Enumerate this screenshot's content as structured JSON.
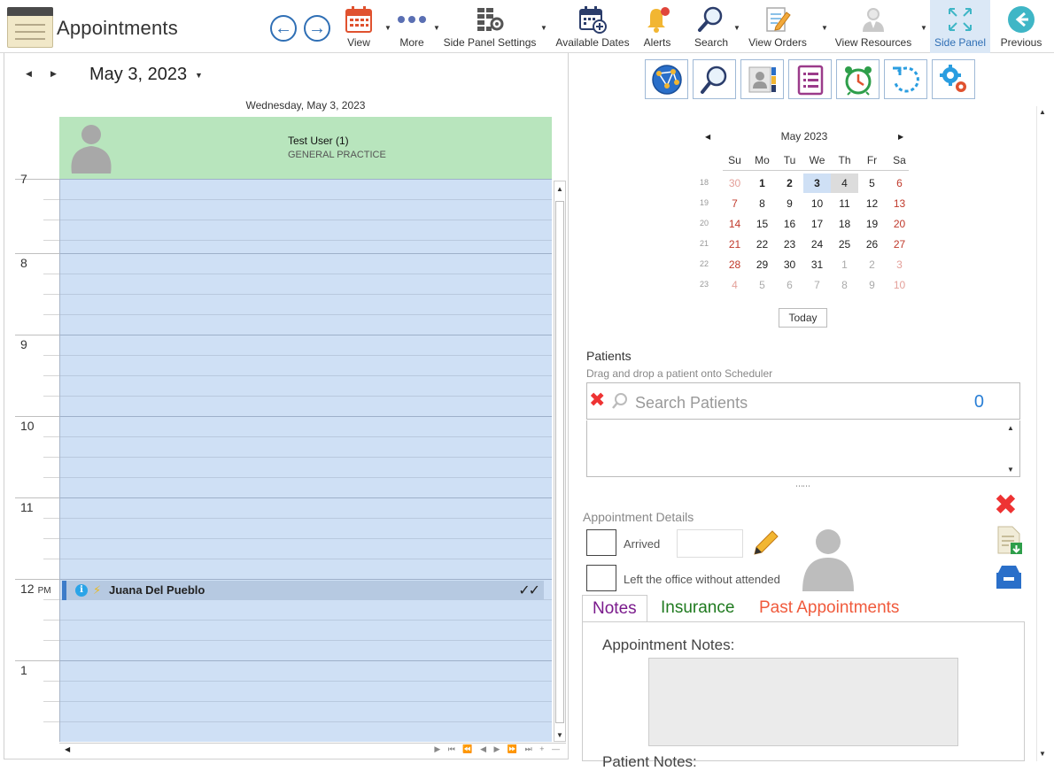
{
  "app": {
    "title": "Appointments"
  },
  "toolbar": {
    "buttons": [
      {
        "label": "View"
      },
      {
        "label": "More"
      },
      {
        "label": "Side Panel Settings"
      },
      {
        "label": "Available Dates"
      },
      {
        "label": "Alerts"
      },
      {
        "label": "Search"
      },
      {
        "label": "View Orders"
      },
      {
        "label": "View Resources"
      },
      {
        "label": "Side Panel"
      },
      {
        "label": "Previous"
      }
    ]
  },
  "scheduler": {
    "date_title": "May 3, 2023",
    "day_header": "Wednesday, May 3, 2023",
    "resource": {
      "name": "Test User (1)",
      "department": "GENERAL PRACTICE"
    },
    "hours": [
      {
        "label": "7",
        "suffix": ""
      },
      {
        "label": "8",
        "suffix": ""
      },
      {
        "label": "9",
        "suffix": ""
      },
      {
        "label": "10",
        "suffix": ""
      },
      {
        "label": "11",
        "suffix": ""
      },
      {
        "label": "12",
        "suffix": "PM"
      },
      {
        "label": "1",
        "suffix": ""
      }
    ],
    "appointment": {
      "patient": "Juana Del Pueblo",
      "info_glyph": "i",
      "status_glyph": "✓✓"
    }
  },
  "calendar": {
    "month_title": "May 2023",
    "dow": [
      "Su",
      "Mo",
      "Tu",
      "We",
      "Th",
      "Fr",
      "Sa"
    ],
    "weeks": [
      {
        "wk": "18",
        "days": [
          "30",
          "1",
          "2",
          "3",
          "4",
          "5",
          "6"
        ]
      },
      {
        "wk": "19",
        "days": [
          "7",
          "8",
          "9",
          "10",
          "11",
          "12",
          "13"
        ]
      },
      {
        "wk": "20",
        "days": [
          "14",
          "15",
          "16",
          "17",
          "18",
          "19",
          "20"
        ]
      },
      {
        "wk": "21",
        "days": [
          "21",
          "22",
          "23",
          "24",
          "25",
          "26",
          "27"
        ]
      },
      {
        "wk": "22",
        "days": [
          "28",
          "29",
          "30",
          "31",
          "1",
          "2",
          "3"
        ]
      },
      {
        "wk": "23",
        "days": [
          "4",
          "5",
          "6",
          "7",
          "8",
          "9",
          "10"
        ]
      }
    ],
    "today_label": "Today"
  },
  "patients": {
    "title": "Patients",
    "hint": "Drag and drop a patient onto Scheduler",
    "search_placeholder": "Search Patients",
    "count": "0"
  },
  "details": {
    "title": "Appointment Details",
    "arrived_label": "Arrived",
    "left_label": "Left the office without attended"
  },
  "tabs": [
    {
      "label": "Notes",
      "color": "#7a1a8c"
    },
    {
      "label": "Insurance",
      "color": "#1f7a1f"
    },
    {
      "label": "Past Appointments",
      "color": "#f05a3c"
    }
  ],
  "notes": {
    "appointment_notes_label": "Appointment Notes:",
    "patient_notes_label": "Patient Notes:"
  },
  "colors": {
    "accent": "#2f6fb5",
    "resource_bg": "#b8e5bd",
    "schedule_bg": "#cfe0f5"
  }
}
